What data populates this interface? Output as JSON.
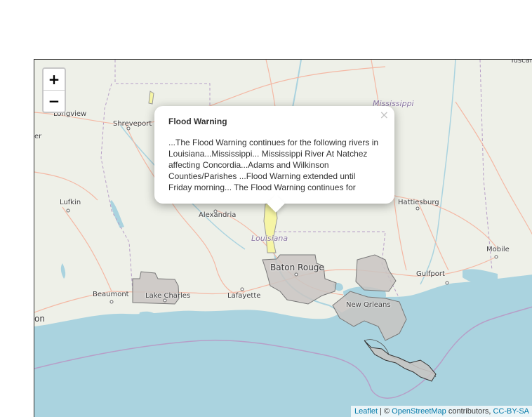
{
  "map": {
    "zoom_in_label": "+",
    "zoom_out_label": "−",
    "colors": {
      "water": "#aad3df",
      "land": "#eef0e8",
      "warning_fill": "#c9c4c2",
      "flood_warning_fill": "#f6f5a5",
      "road": "#f4b8a4",
      "boundary": "#b79ec7"
    },
    "labels": {
      "tuscaloosa": "Tuscalo",
      "mississippi": "Mississippi",
      "longview": "Longview",
      "shreveport": "Shreveport",
      "tyler": "er",
      "lufkin": "Lufkin",
      "alexandria": "Alexandria",
      "hattiesburg": "Hattiesburg",
      "louisiana": "Louisiana",
      "baton_rouge": "Baton Rouge",
      "mobile": "Mobile",
      "gulfport": "Gulfport",
      "beaumont": "Beaumont",
      "lake_charles": "Lake Charles",
      "lafayette": "Lafayette",
      "new_orleans": "New Orleans",
      "houston": "on"
    }
  },
  "popup": {
    "title": "Flood Warning",
    "body": "...The Flood Warning continues for the following rivers in Louisiana...Mississippi... Mississippi River At Natchez affecting Concordia...Adams and Wilkinson Counties/Parishes ...Flood Warning extended until Friday morning... The Flood Warning continues for",
    "close_label": "×"
  },
  "attribution": {
    "leaflet": "Leaflet",
    "sep": " | © ",
    "osm": "OpenStreetMap",
    "contributors": " contributors, ",
    "license": "CC-BY-SA"
  }
}
